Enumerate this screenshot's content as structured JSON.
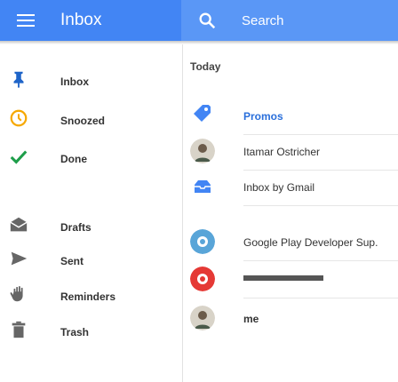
{
  "app": {
    "title": "Inbox",
    "search_label": "Search"
  },
  "colors": {
    "primary": "#4285f4",
    "search_bg": "#5a97f6",
    "promos": "#4285f4",
    "google_play": "#59a5d8",
    "red": "#e53935"
  },
  "nav": {
    "items": [
      {
        "label": "Inbox",
        "icon": "pin-icon"
      },
      {
        "label": "Snoozed",
        "icon": "clock-icon"
      },
      {
        "label": "Done",
        "icon": "check-icon"
      },
      {
        "label": "Drafts",
        "icon": "drafts-icon"
      },
      {
        "label": "Sent",
        "icon": "send-icon"
      },
      {
        "label": "Reminders",
        "icon": "reminder-hand-icon"
      },
      {
        "label": "Trash",
        "icon": "trash-icon"
      }
    ]
  },
  "main": {
    "section_label": "Today",
    "rows": [
      {
        "label": "Promos",
        "icon": "promos-tag-icon"
      },
      {
        "label": "Itamar Ostricher",
        "icon": "avatar-itamar"
      },
      {
        "label": "Inbox by Gmail",
        "icon": "inbox-by-gmail-icon"
      },
      {
        "label": "Google Play Developer Sup.",
        "icon": "google-play-avatar"
      },
      {
        "label": "",
        "icon": "red-avatar"
      },
      {
        "label": "me",
        "icon": "avatar-me"
      }
    ]
  }
}
